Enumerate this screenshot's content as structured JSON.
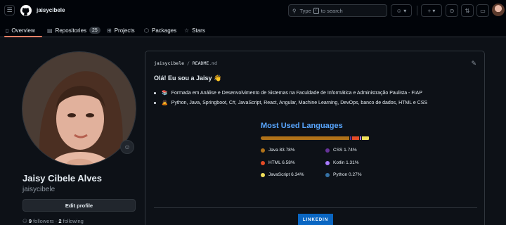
{
  "header": {
    "username": "jaisycibele",
    "search_text": "Type",
    "search_key": "/",
    "search_text_after": "to search",
    "buttons": [
      {
        "icon": "copilot-icon"
      },
      {
        "icon": "plus-icon"
      },
      {
        "icon": "issues-icon"
      },
      {
        "icon": "pull-requests-icon"
      },
      {
        "icon": "inbox-icon"
      }
    ]
  },
  "tabs": [
    {
      "label": "Overview",
      "icon": "book-icon",
      "selected": true
    },
    {
      "label": "Repositories",
      "icon": "repo-icon",
      "count": "25"
    },
    {
      "label": "Projects",
      "icon": "table-icon"
    },
    {
      "label": "Packages",
      "icon": "package-icon"
    },
    {
      "label": "Stars",
      "icon": "star-icon"
    }
  ],
  "profile": {
    "full_name": "Jaisy Cibele Alves",
    "login": "jaisycibele",
    "edit_label": "Edit profile",
    "followers_count": "9",
    "followers_label": "followers",
    "following_count": "2",
    "following_label": "following"
  },
  "readme": {
    "path_user": "jaisycibele",
    "path_sep": " / ",
    "path_file": "README",
    "path_ext": ".md",
    "greeting": "Olá! Eu sou a Jaisy 👋",
    "bullets": [
      {
        "emoji": "📚",
        "text": "Formada em Análise e Desenvolvimento de Sistemas na Faculdade de Informática e Administração Paulista - FIAP"
      },
      {
        "emoji": "🙇",
        "text": "Python, Java, Springboot, C#, JavaScript, React, Angular, Machine Learning, DevOps, banco de dados, HTML e CSS"
      }
    ],
    "langs_title": "Most Used Languages",
    "languages": [
      {
        "name": "Java",
        "percent": "83.78%",
        "value": 83.78,
        "color": "#b07219"
      },
      {
        "name": "CSS",
        "percent": "1.74%",
        "value": 1.74,
        "color": "#663399"
      },
      {
        "name": "HTML",
        "percent": "6.58%",
        "value": 6.58,
        "color": "#e34c26"
      },
      {
        "name": "Kotlin",
        "percent": "1.31%",
        "value": 1.31,
        "color": "#a97bff"
      },
      {
        "name": "JavaScript",
        "percent": "6.34%",
        "value": 6.34,
        "color": "#f1e05a"
      },
      {
        "name": "Python",
        "percent": "0.27%",
        "value": 0.27,
        "color": "#3572a5"
      }
    ],
    "linkedin_label": "LINKEDIN"
  }
}
